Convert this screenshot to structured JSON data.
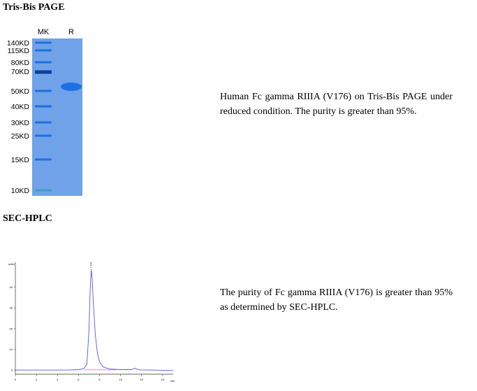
{
  "sections": [
    {
      "heading": "Tris-Bis PAGE",
      "description": "Human Fc gamma RIIIA (V176) on Tris-Bis PAGE under reduced condition. The purity is greater than 95%."
    },
    {
      "heading": "SEC-HPLC",
      "description": "The purity of Fc gamma RIIIA (V176) is greater than 95% as determined by SEC-HPLC."
    }
  ],
  "gel": {
    "lanes": [
      "MK",
      "R"
    ],
    "markers": [
      "140KD",
      "115KD",
      "80KD",
      "70KD",
      "50KD",
      "40KD",
      "30KD",
      "25KD",
      "15KD",
      "10KD"
    ],
    "sample_band_kd": 55,
    "colors": {
      "gel": "#6fa2e8",
      "band": "#1f6fe0"
    }
  },
  "chart_data": {
    "type": "line",
    "ylabel": "mAU",
    "xlabel": "min",
    "xlim": [
      0,
      15
    ],
    "ylim": [
      -2,
      52
    ],
    "xticks": [
      0,
      2,
      4,
      6,
      8,
      10,
      12,
      14
    ],
    "yticks": [
      0,
      10,
      20,
      30,
      40
    ],
    "peak_label": "7.215",
    "series": [
      {
        "color": "#5555ee",
        "x": [
          0,
          5,
          6,
          6.5,
          6.8,
          7.0,
          7.1,
          7.215,
          7.3,
          7.4,
          7.6,
          7.8,
          8.0,
          8.3,
          8.6,
          9,
          10,
          11,
          11.2,
          11.35,
          11.5,
          11.8,
          13,
          15
        ],
        "y": [
          0,
          0,
          0.2,
          0.6,
          3,
          20,
          38,
          48.5,
          44,
          33,
          17,
          8,
          4,
          1.8,
          1,
          0.5,
          0.2,
          0.2,
          0.6,
          0.9,
          0.5,
          0.1,
          0,
          -0.2
        ]
      }
    ]
  }
}
